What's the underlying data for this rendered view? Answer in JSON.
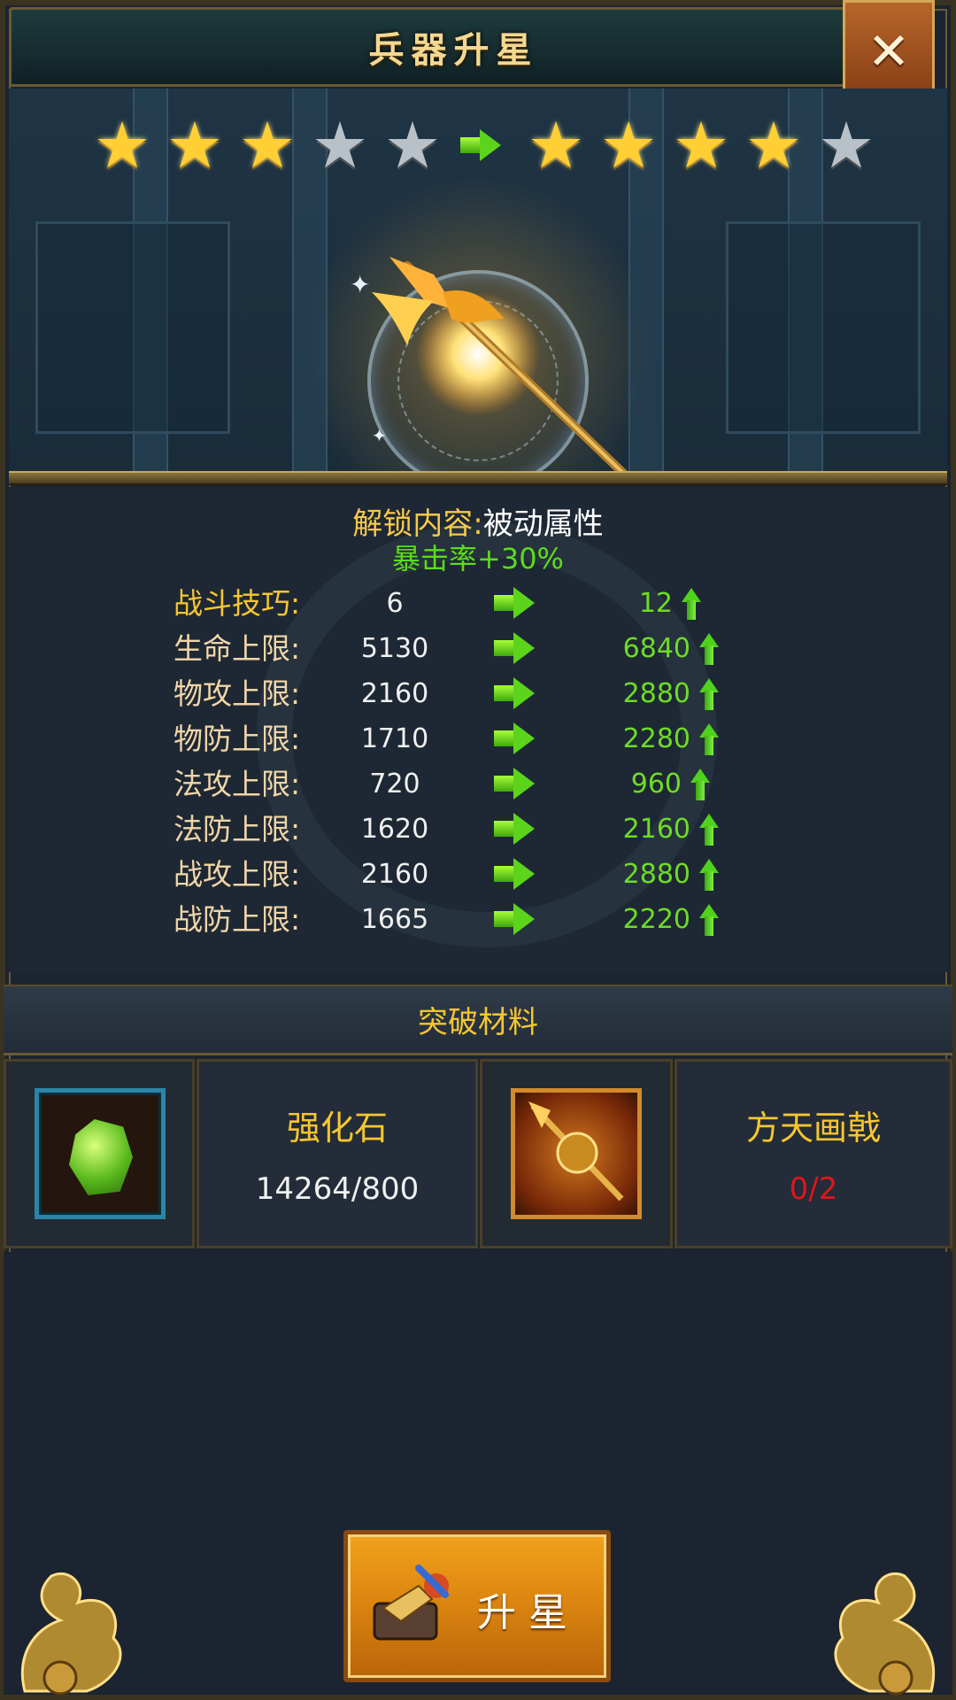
{
  "header": {
    "title": "兵器升星",
    "close_label": "✕"
  },
  "stars": {
    "current": {
      "filled": 3,
      "total": 5
    },
    "next": {
      "filled": 4,
      "total": 5
    }
  },
  "unlock": {
    "label": "解锁内容:",
    "value": "被动属性",
    "effect": "暴击率+30%"
  },
  "stats": [
    {
      "label": "战斗技巧:",
      "current": "6",
      "next": "12",
      "highlight": true
    },
    {
      "label": "生命上限:",
      "current": "5130",
      "next": "6840"
    },
    {
      "label": "物攻上限:",
      "current": "2160",
      "next": "2880"
    },
    {
      "label": "物防上限:",
      "current": "1710",
      "next": "2280"
    },
    {
      "label": "法攻上限:",
      "current": "720",
      "next": "960"
    },
    {
      "label": "法防上限:",
      "current": "1620",
      "next": "2160"
    },
    {
      "label": "战攻上限:",
      "current": "2160",
      "next": "2880"
    },
    {
      "label": "战防上限:",
      "current": "1665",
      "next": "2220"
    }
  ],
  "materials": {
    "header": "突破材料",
    "items": [
      {
        "name": "强化石",
        "count": "14264/800",
        "icon": "green-gem-icon",
        "sufficient": true
      },
      {
        "name": "方天画戟",
        "count": "0/2",
        "icon": "halberd-icon",
        "sufficient": false
      }
    ]
  },
  "upgrade_button": {
    "label": "升星"
  },
  "colors": {
    "gold": "#f6c630",
    "green": "#6edc26",
    "red": "#e0151a",
    "button": "#d9840f"
  }
}
